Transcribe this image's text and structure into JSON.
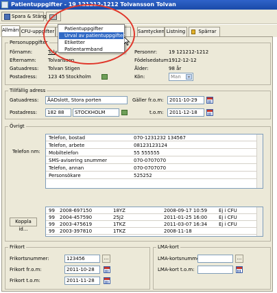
{
  "window": {
    "title": "Patientuppgifter - 19 121212-1212 Tolvansson Tolvan"
  },
  "toolbar": {
    "save_close": "Spara & Stäng"
  },
  "tabs": [
    "Allmänt",
    "CFU-uppgifter",
    "",
    "Samtycken",
    "Listning",
    "Spärrar"
  ],
  "menu": {
    "items": [
      "Patientuppgifter",
      "Urval av patientuppgifter",
      "Etiketter",
      "Patientarmband"
    ],
    "selected": 1
  },
  "personuppgifter": {
    "title": "Personuppgifter",
    "fornamn_label": "Förnamn:",
    "fornamn": "Tolv",
    "efternamn_label": "Efternamn:",
    "efternamn": "Tolvansson",
    "gatuadress_label": "Gatuadress:",
    "gatuadress": "Tolvan Stigen",
    "postadress_label": "Postadress:",
    "postnr": "123 45",
    "ort": "Stockholm",
    "personnr_label": "Personnr:",
    "personnr": "19 121212-1212",
    "fodelsedatum_label": "Födelsedatum:",
    "fodelsedatum": "1912-12-12",
    "alder_label": "Ålder:",
    "alder": "98 år",
    "kon_label": "Kön:",
    "kon": "Man"
  },
  "tillfallig": {
    "title": "Tillfällig adress",
    "gatuadress_label": "Gatuadress:",
    "gatuadress": "ÅADslott, Stora porten",
    "postadress_label": "Postadress:",
    "postnr": "182 88",
    "ort": "STOCKHOLM",
    "galler_label": "Gäller fr.o.m:",
    "galler_from": "2011-10-29",
    "tom_label": "t.o.m:",
    "tom": "2011-12-18"
  },
  "ovrigt": {
    "title": "Övrigt",
    "telefon_label": "Telefon nm:",
    "phones": [
      {
        "type": "Telefon, bostad",
        "number": "070-1231232  134567"
      },
      {
        "type": "Telefon, arbete",
        "number": "08123123124"
      },
      {
        "type": "Mobiltelefon",
        "number": "55 555555"
      },
      {
        "type": "SMS-avisering snummer",
        "number": "070-0707070"
      },
      {
        "type": "Telefon, annan",
        "number": "070-0707070"
      },
      {
        "type": "Personsökare",
        "number": "525252"
      }
    ],
    "koppla_label": "Koppla id...",
    "ids": [
      {
        "c1": "99",
        "c2": "2008-697150",
        "c3": "18YZ",
        "c4": "2008-09-17 10:59",
        "c5": "Ej i CFU"
      },
      {
        "c1": "99",
        "c2": "2004-457590",
        "c3": "25J2",
        "c4": "2011-01-25 16:00",
        "c5": "Ej i CFU"
      },
      {
        "c1": "99",
        "c2": "2003-475619",
        "c3": "1TKZ",
        "c4": "2011-03-07 16:34",
        "c5": "Ej i CFU"
      },
      {
        "c1": "99",
        "c2": "2003-397810",
        "c3": "1TKZ",
        "c4": "2008-11-18",
        "c5": ""
      }
    ]
  },
  "frikort": {
    "title": "Frikort",
    "nummer_label": "Frikortsnummer:",
    "nummer": "123456",
    "from_label": "Frikort fr.o.m:",
    "from": "2011-10-28",
    "tom_label": "Frikort t.o.m:",
    "tom": "2011-11-28"
  },
  "lma": {
    "title": "LMA-kort",
    "nummer_label": "LMA-kortsnummer:",
    "nummer": "",
    "tom_label": "LMA-kort t.o.m:",
    "tom": ""
  },
  "colors": {
    "titlebar": "#1a4aa8",
    "highlight": "#316ac5",
    "annotation": "#e0362a"
  }
}
